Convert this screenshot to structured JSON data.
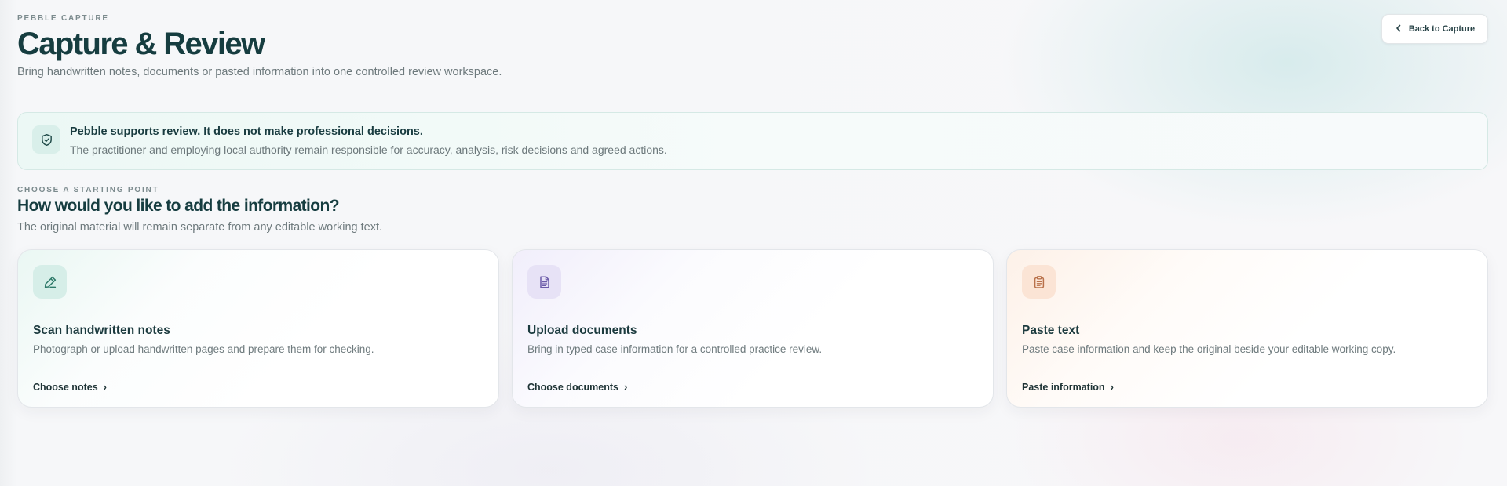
{
  "header": {
    "eyebrow": "PEBBLE CAPTURE",
    "title": "Capture & Review",
    "subtitle": "Bring handwritten notes, documents or pasted information into one controlled review workspace.",
    "back_label": "Back to Capture",
    "back_icon": "chevron-left-icon"
  },
  "notice": {
    "icon": "shield-check-icon",
    "title": "Pebble supports review. It does not make professional decisions.",
    "body": "The practitioner and employing local authority remain responsible for accuracy, analysis, risk decisions and agreed actions."
  },
  "section": {
    "eyebrow": "CHOOSE A STARTING POINT",
    "title": "How would you like to add the information?",
    "subtitle": "The original material will remain separate from any editable working text."
  },
  "cards": [
    {
      "icon": "pen-icon",
      "accent": "#2f7a6a",
      "title": "Scan handwritten notes",
      "description": "Photograph or upload handwritten pages and prepare them for checking.",
      "link": "Choose notes",
      "link_chevron": "›"
    },
    {
      "icon": "document-icon",
      "accent": "#6b5aa8",
      "title": "Upload documents",
      "description": "Bring in typed case information for a controlled practice review.",
      "link": "Choose documents",
      "link_chevron": "›"
    },
    {
      "icon": "clipboard-icon",
      "accent": "#b9714a",
      "title": "Paste text",
      "description": "Paste case information and keep the original beside your editable working copy.",
      "link": "Paste information",
      "link_chevron": "›"
    }
  ]
}
